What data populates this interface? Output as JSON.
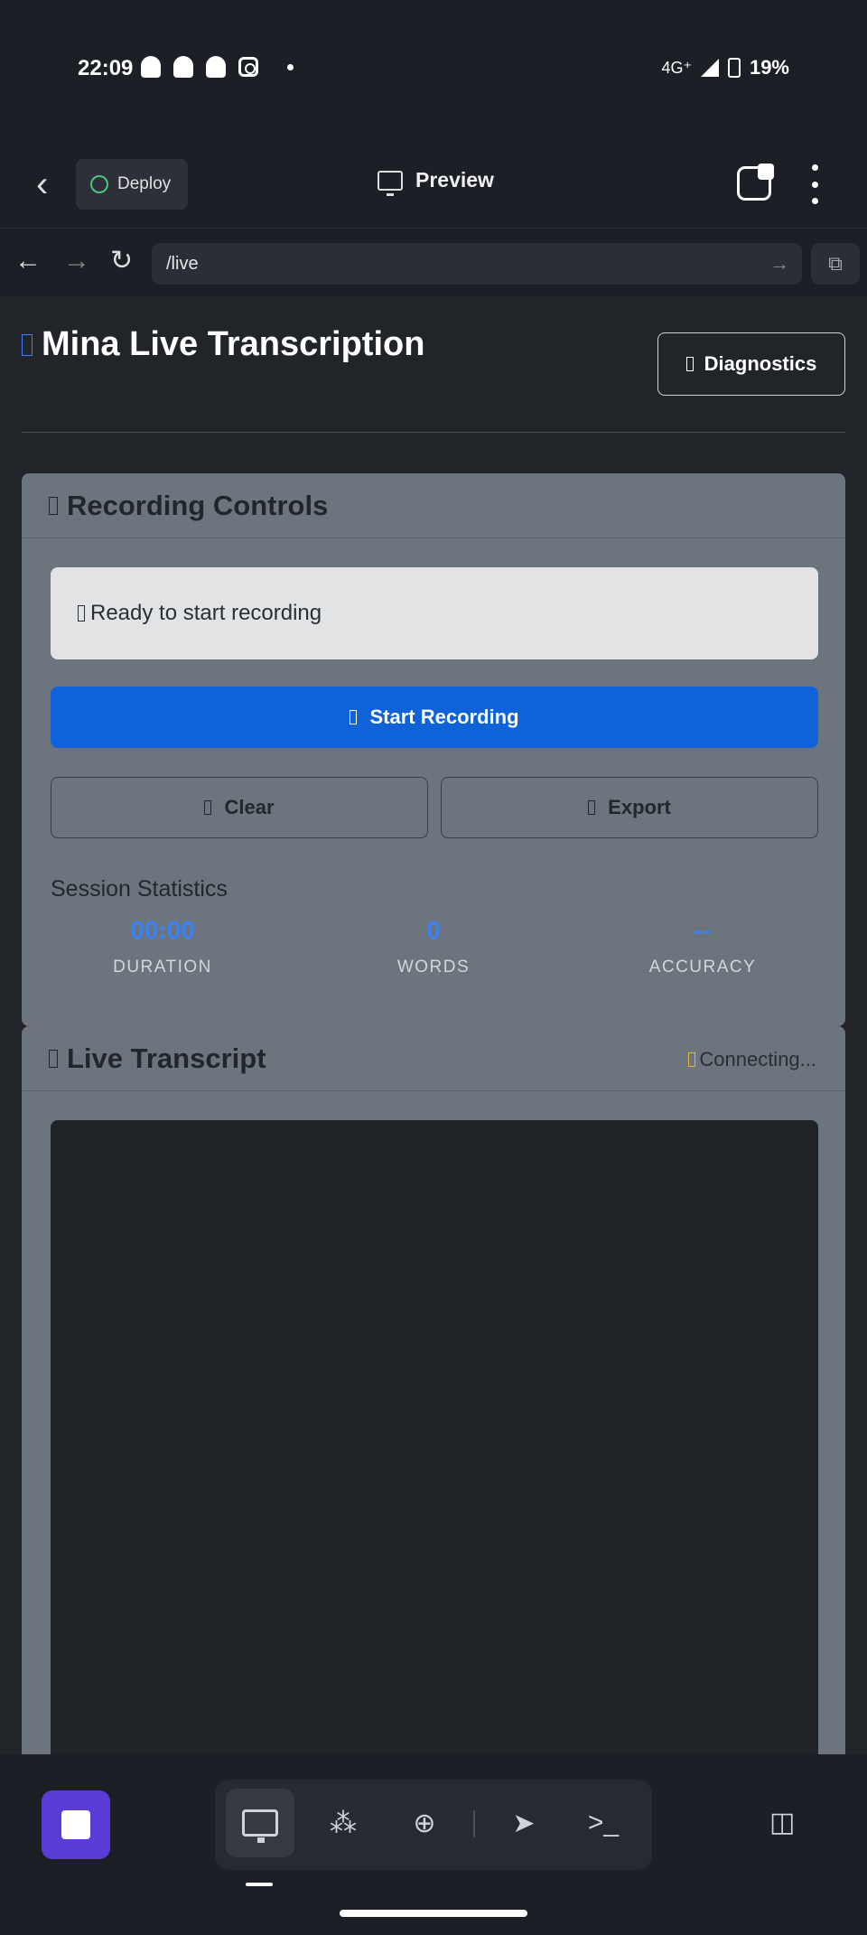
{
  "status_bar": {
    "time": "22:09",
    "network": "4G⁺",
    "battery": "19%"
  },
  "app_header": {
    "deploy_label": "Deploy",
    "preview_label": "Preview"
  },
  "url_bar": {
    "url": "/live"
  },
  "page": {
    "title": "Mina Live Transcription",
    "diagnostics_label": "Diagnostics",
    "recording_controls": {
      "title": "Recording Controls",
      "status_text": "Ready to start recording",
      "start_label": "Start Recording",
      "clear_label": "Clear",
      "export_label": "Export",
      "stats_title": "Session Statistics",
      "stats": [
        {
          "value": "00:00",
          "label": "DURATION"
        },
        {
          "value": "0",
          "label": "WORDS"
        },
        {
          "value": "--",
          "label": "ACCURACY"
        }
      ]
    },
    "live_transcript": {
      "title": "Live Transcript",
      "connection_status": "Connecting..."
    }
  },
  "colors": {
    "accent_blue": "#0f62d8",
    "stat_blue": "#3b82f6",
    "stop_purple": "#5b3bd6",
    "connecting_yellow": "#e0b43a"
  },
  "icons": {
    "missing_glyph": "▯"
  }
}
